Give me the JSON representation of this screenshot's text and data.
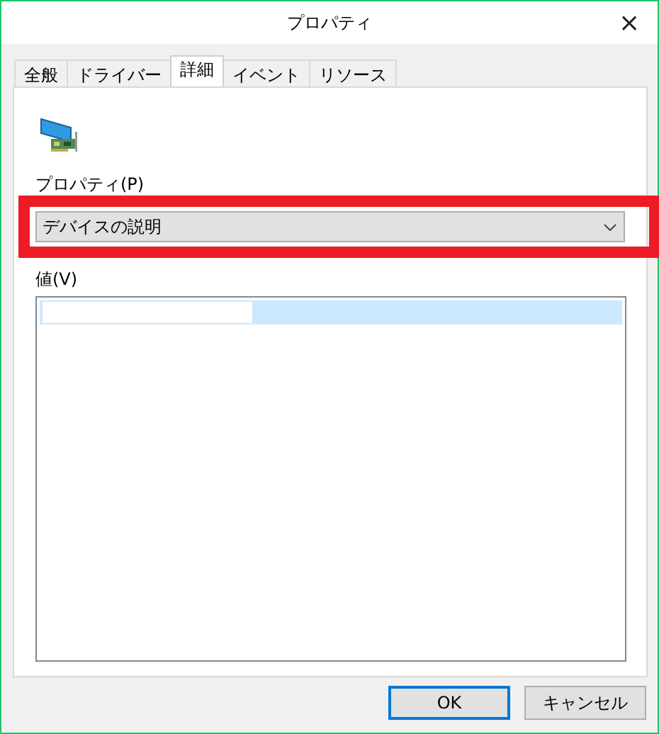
{
  "window": {
    "title": "プロパティ",
    "close": "×"
  },
  "tabs": [
    {
      "label": "全般",
      "selected": false
    },
    {
      "label": "ドライバー",
      "selected": false
    },
    {
      "label": "詳細",
      "selected": true
    },
    {
      "label": "イベント",
      "selected": false
    },
    {
      "label": "リソース",
      "selected": false
    }
  ],
  "property": {
    "label": "プロパティ(P)",
    "value": "デバイスの説明",
    "highlighted": true
  },
  "values": {
    "label": "値(V)",
    "rows": [
      {
        "selected": true,
        "redacted": true
      }
    ]
  },
  "buttons": [
    {
      "label": "OK",
      "default": true
    },
    {
      "label": "キャンセル",
      "default": false
    }
  ]
}
